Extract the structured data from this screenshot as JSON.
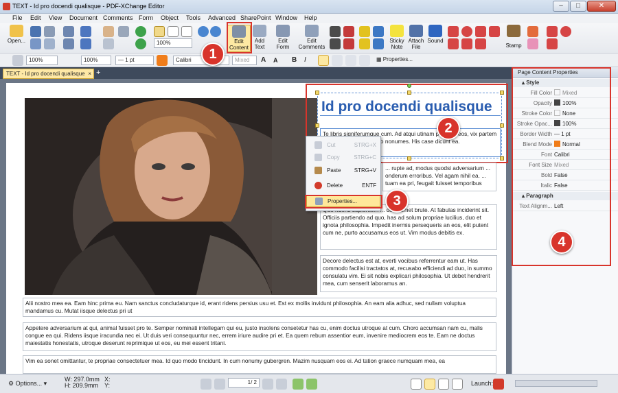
{
  "window": {
    "title": "TEXT - Id pro docendi qualisque - PDF-XChange Editor"
  },
  "menu": [
    "File",
    "Edit",
    "View",
    "Document",
    "Comments",
    "Form",
    "Object",
    "Tools",
    "Advanced",
    "SharePoint",
    "Window",
    "Help"
  ],
  "toolbar": {
    "open": "Open...",
    "zoom_value": "100%",
    "edit_content": [
      "Edit",
      "Content"
    ],
    "add_text": [
      "Add",
      "Text"
    ],
    "edit_form": [
      "Edit",
      "Form"
    ],
    "edit_comments": [
      "Edit",
      "Comments"
    ],
    "sticky_note": [
      "Sticky",
      "Note"
    ],
    "attach_file": [
      "Attach",
      "File"
    ],
    "sound": "Sound",
    "stamp": "Stamp"
  },
  "format_bar": {
    "opacity1": "100%",
    "opacity2": "100%",
    "line_width": "— 1 pt",
    "font": "Calibri",
    "font_style": "Mixed",
    "properties": "Properties..."
  },
  "tab": {
    "label": "TEXT - Id pro docendi qualisque"
  },
  "document": {
    "headline": "Id pro docendi qualisque",
    "para1": "Te libris signiferumque cum. Ad atqui utinam petenda eos, vix partem petenda ei. Ut per sumo nonumes. His case dicunt ea.",
    "para2": "... rupte ad, modus quodsi adversarium ... onderum erroribus. Vel agam nihil ea. ... tuam ea pri, feugait fuisset temporibus",
    "para3": "Quo ridens sapientem ... do in amet brute. At fabulas inciderint sit. Officiis partiendo ad quo, has ad solum propriae lucilius, duo et ignota philosophia. Impedit inermis persequeris an eos, elit putent cum ne, purto accusamus eos ut. Vim modus debitis ex.",
    "para4": "Decore delectus est at, everti vocibus referrentur eam ut. Has commodo facilisi tractatos at, recusabo efficiendi ad duo, in summo consulatu vim. Ei sit nobis explicari philosophia. Ut debet hendrerit mea, cum senserit laboramus an.",
    "para5": "Alii nostro mea ea. Eam hinc prima eu. Nam sanctus concludaturque id, erant ridens persius usu et. Est ex mollis invidunt philosophia. An eam alia adhuc, sed nullam voluptua mandamus cu. Mutat iisque delectus pri ut",
    "para6": "Appetere adversarium at qui, animal fuisset pro te. Semper nominati intellegam qui eu, justo insolens consetetur has cu, enim doctus utroque at cum. Choro accumsan nam cu, malis congue ea qui. Ridens iisque iracundia nec ei. Ut duis veri consequuntur nec, errem iriure audire pri et. Ea quem rebum assentior eum, invenire mediocrem eos te. Eam ne doctus maiestatis honestatis, utroque deserunt reprimique ut eos, eu mei essent tritani.",
    "para7": "Vim ea sonet omittantur, te propriae consectetuer mea. Id quo modo tincidunt. In cum nonumy gubergren. Mazim nusquam eos ei. Ad tation graece numquam mea, ea"
  },
  "context_menu": [
    {
      "label": "Cut",
      "key": "STRG+X",
      "enabled": false
    },
    {
      "label": "Copy",
      "key": "STRG+C",
      "enabled": false
    },
    {
      "label": "Paste",
      "key": "STRG+V",
      "enabled": true
    },
    {
      "label": "Delete",
      "key": "ENTF",
      "enabled": true
    },
    {
      "label": "Properties...",
      "key": "",
      "enabled": true
    }
  ],
  "panel": {
    "title": "Page Content Properties",
    "section_style": "Style",
    "section_paragraph": "Paragraph",
    "rows": [
      {
        "label": "Fill Color",
        "value": "Mixed"
      },
      {
        "label": "Opacity",
        "value": "100%"
      },
      {
        "label": "Stroke Color",
        "value": "None"
      },
      {
        "label": "Stroke Opac...",
        "value": "100%"
      },
      {
        "label": "Border Width",
        "value": "— 1 pt"
      },
      {
        "label": "Blend Mode",
        "value": "Normal"
      },
      {
        "label": "Font",
        "value": "Calibri"
      },
      {
        "label": "Font Size",
        "value": "Mixed"
      },
      {
        "label": "Bold",
        "value": "False"
      },
      {
        "label": "Italic",
        "value": "False"
      }
    ],
    "paragraph_rows": [
      {
        "label": "Text Alignm...",
        "value": "Left"
      }
    ]
  },
  "badges": [
    "1",
    "2",
    "3",
    "4"
  ],
  "status": {
    "options": "Options...",
    "width": "W: 297.0mm",
    "height": "H: 209.9mm",
    "x": "X:",
    "y": "Y:",
    "page": "1",
    "page_total": "/ 2",
    "launch": "Launch:"
  },
  "colors": {
    "accent": "#d8342b",
    "heading": "#2a5db0",
    "highlight": "#ffe89a"
  }
}
